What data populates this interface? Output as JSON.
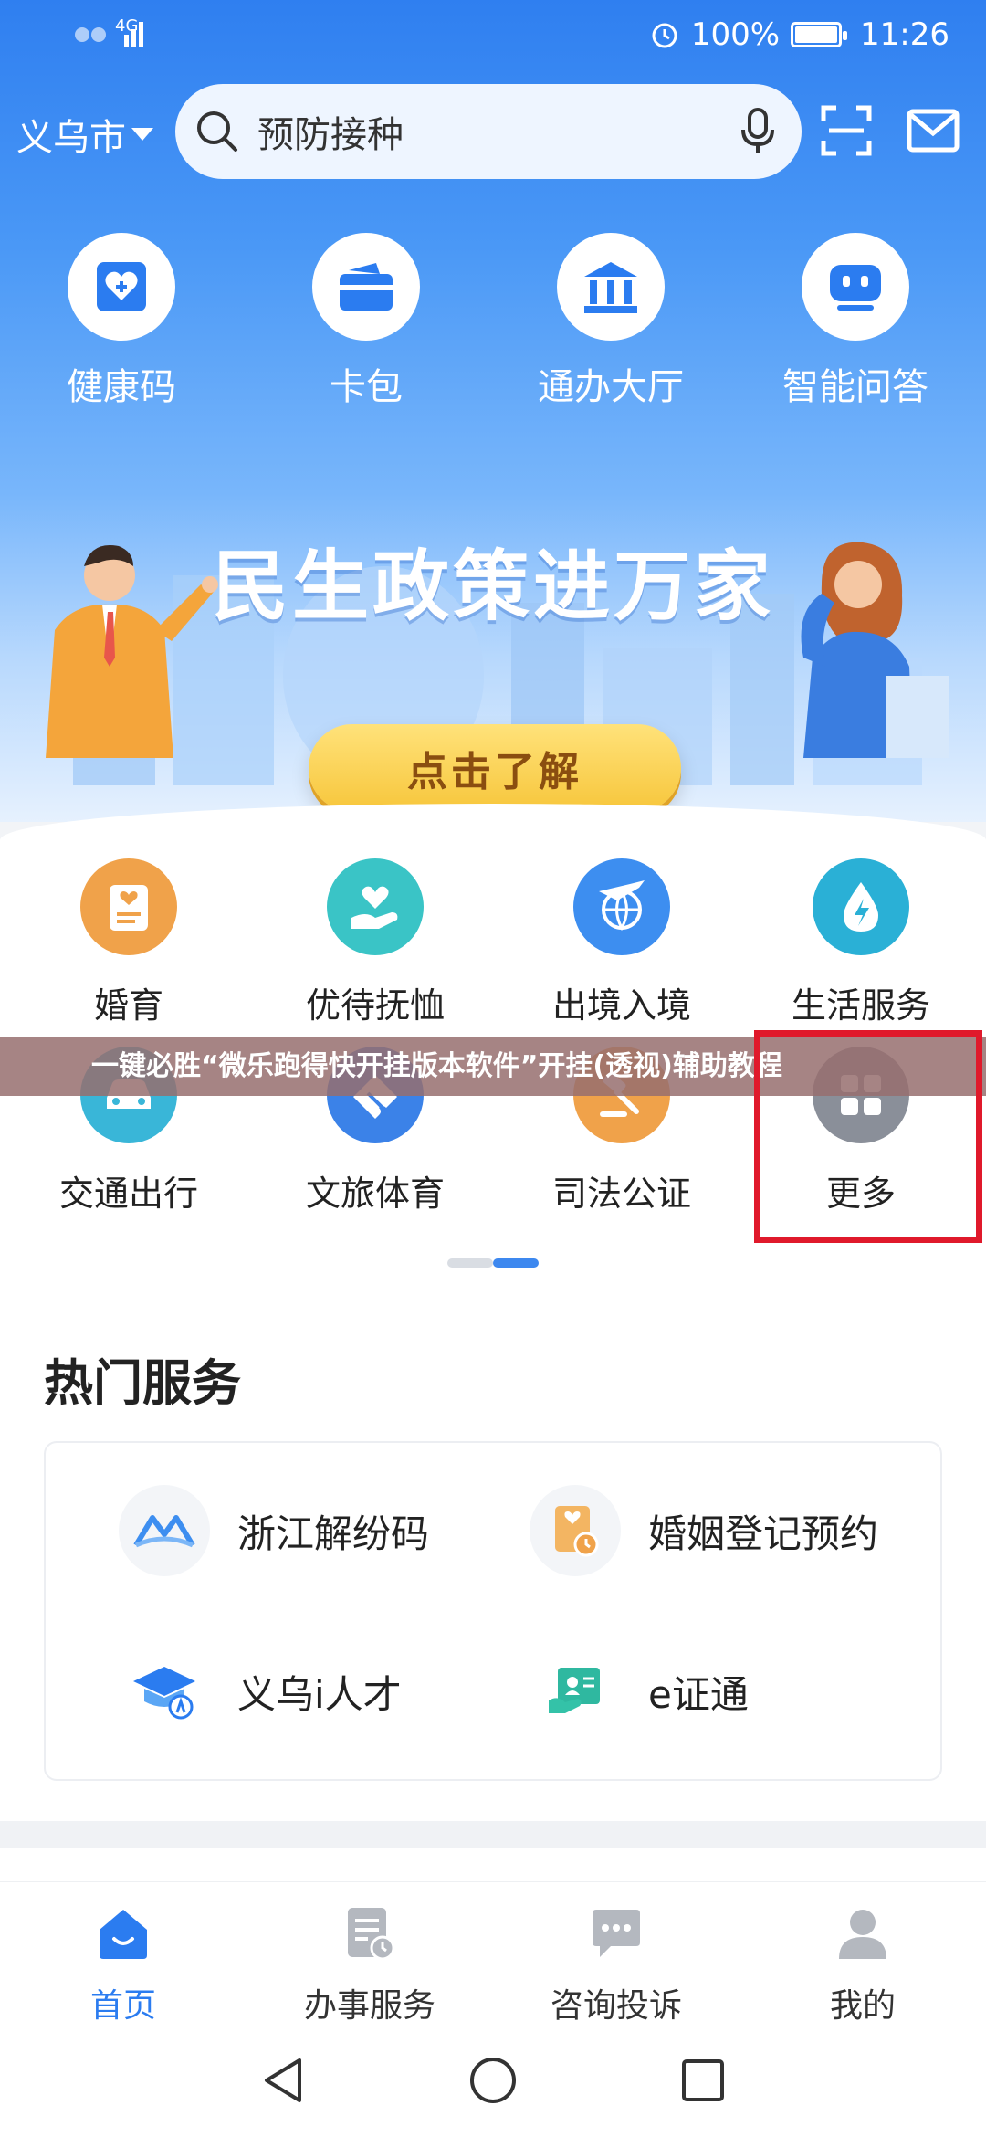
{
  "status_bar": {
    "network": "4G",
    "battery_percent": "100%",
    "time": "11:26"
  },
  "header": {
    "city": "义乌市",
    "search_placeholder": "预防接种"
  },
  "quick_actions": [
    {
      "label": "健康码",
      "icon": "health-code-icon"
    },
    {
      "label": "卡包",
      "icon": "wallet-icon"
    },
    {
      "label": "通办大厅",
      "icon": "government-hall-icon"
    },
    {
      "label": "智能问答",
      "icon": "robot-icon"
    }
  ],
  "banner": {
    "title": "民生政策进万家",
    "button_label": "点击了解"
  },
  "services": [
    {
      "label": "婚育",
      "icon": "marriage-icon",
      "color": "#f0a24a"
    },
    {
      "label": "优待抚恤",
      "icon": "care-hand-icon",
      "color": "#3ac4c6"
    },
    {
      "label": "出境入境",
      "icon": "plane-globe-icon",
      "color": "#3d8ef0"
    },
    {
      "label": "生活服务",
      "icon": "water-drop-icon",
      "color": "#2ab0d6"
    },
    {
      "label": "交通出行",
      "icon": "car-icon",
      "color": "#39b6d8"
    },
    {
      "label": "文旅体育",
      "icon": "ticket-icon",
      "color": "#3b82e8"
    },
    {
      "label": "司法公证",
      "icon": "gavel-icon",
      "color": "#f0a24a"
    },
    {
      "label": "更多",
      "icon": "grid-more-icon",
      "color": "#8a8f99"
    }
  ],
  "overlay_text": "一键必胜“微乐跑得快开挂版本软件”开挂(透视)辅助教程",
  "hot_services": {
    "title": "热门服务",
    "items": [
      {
        "label": "浙江解纷码",
        "icon": "zhejiang-dispute-icon"
      },
      {
        "label": "婚姻登记预约",
        "icon": "marriage-registration-icon"
      },
      {
        "label": "义乌i人才",
        "icon": "talent-cap-icon"
      },
      {
        "label": "e证通",
        "icon": "certificate-icon"
      }
    ]
  },
  "bottom_nav": [
    {
      "label": "首页",
      "icon": "home-icon",
      "active": true
    },
    {
      "label": "办事服务",
      "icon": "document-clock-icon",
      "active": false
    },
    {
      "label": "咨询投诉",
      "icon": "chat-bubble-icon",
      "active": false
    },
    {
      "label": "我的",
      "icon": "user-icon",
      "active": false
    }
  ],
  "colors": {
    "primary": "#2b7cf0",
    "highlight_border": "#e0192b",
    "button_gold": "#f7c63b"
  }
}
